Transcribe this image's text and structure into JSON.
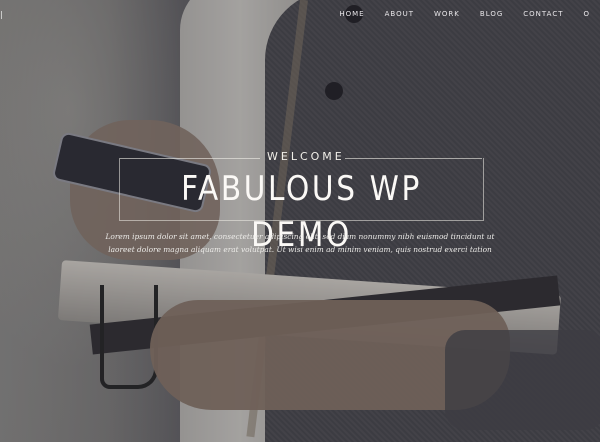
{
  "nav": {
    "items": [
      "HOME",
      "ABOUT",
      "WORK",
      "BLOG",
      "CONTACT",
      "O"
    ]
  },
  "hero": {
    "eyebrow": "WELCOME",
    "title": "FABULOUS WP DEMO",
    "body": "Lorem ipsum dolor sit amet, consectetuer adipiscing elit, sed diam nonummy nibh euismod tincidunt ut laoreet dolore magna aliquam erat volutpat. Ut wisi enim ad minim veniam, quis nostrud exerci tation"
  },
  "colors": {
    "text": "#fbf9f6",
    "overlay": "#282630"
  }
}
